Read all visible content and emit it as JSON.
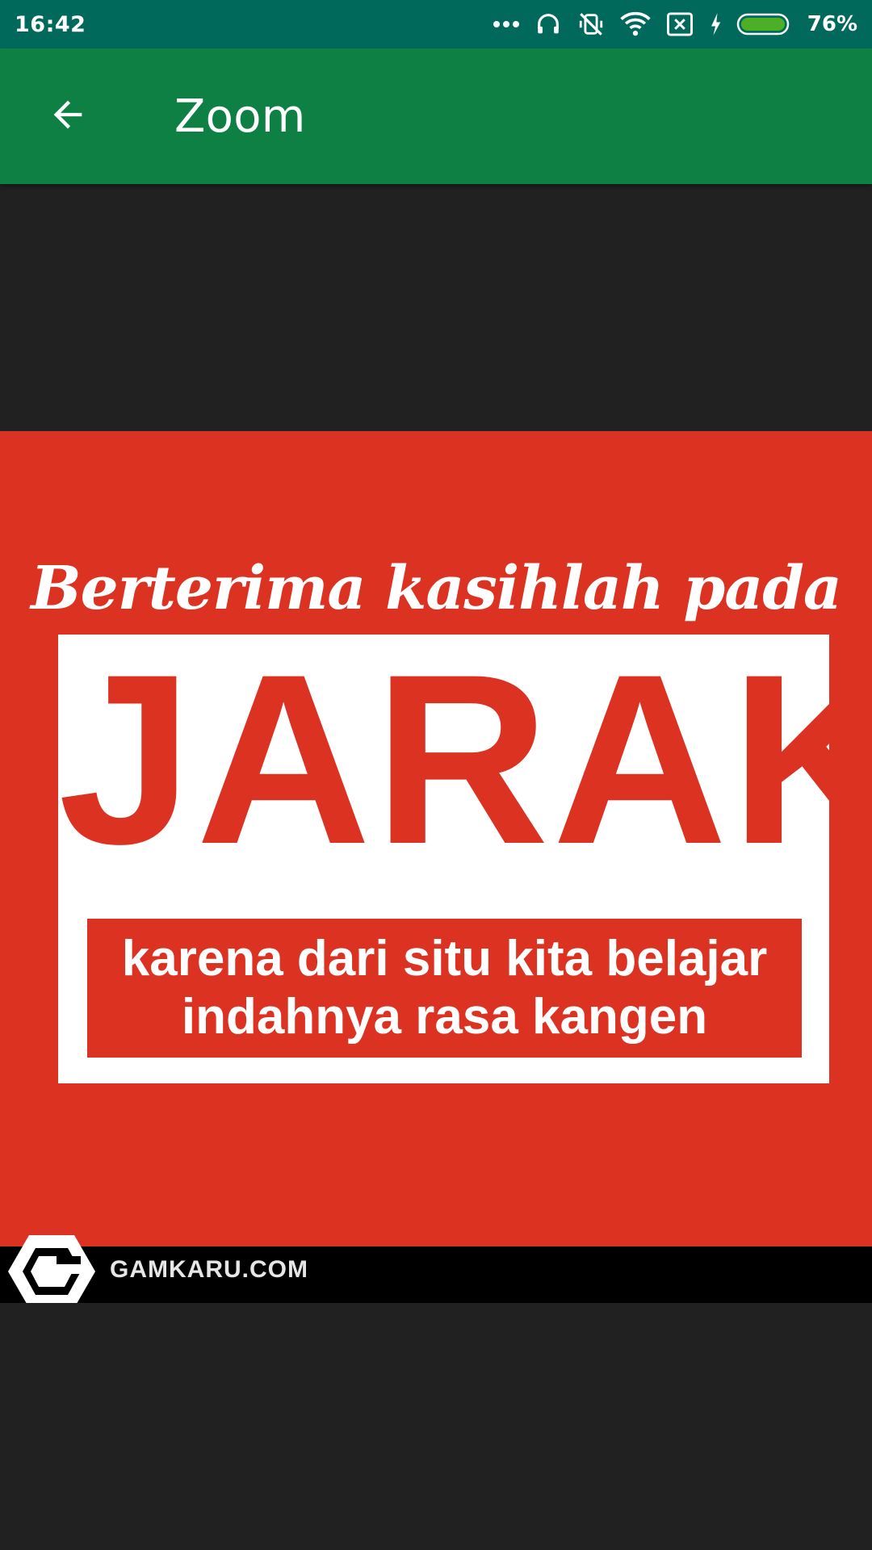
{
  "status_bar": {
    "time": "16:42",
    "battery_percent": "76%",
    "battery_level": 0.76,
    "icons": [
      "more-dots-icon",
      "headset-icon",
      "vibrate-off-icon",
      "wifi-icon",
      "no-sim-icon",
      "charging-icon",
      "battery-icon"
    ]
  },
  "app_bar": {
    "title": "Zoom",
    "back_icon": "arrow-back-icon"
  },
  "image": {
    "script_line": "Berterima kasihlah pada",
    "big_word": "JARAK",
    "band_line_1": "karena dari situ kita belajar",
    "band_line_2": "indahnya rasa kangen",
    "site": "GAMKARU.COM"
  },
  "colors": {
    "status_bar": "#00695c",
    "app_bar": "#0e8043",
    "background": "#212121",
    "poster_red": "#dc3222"
  }
}
